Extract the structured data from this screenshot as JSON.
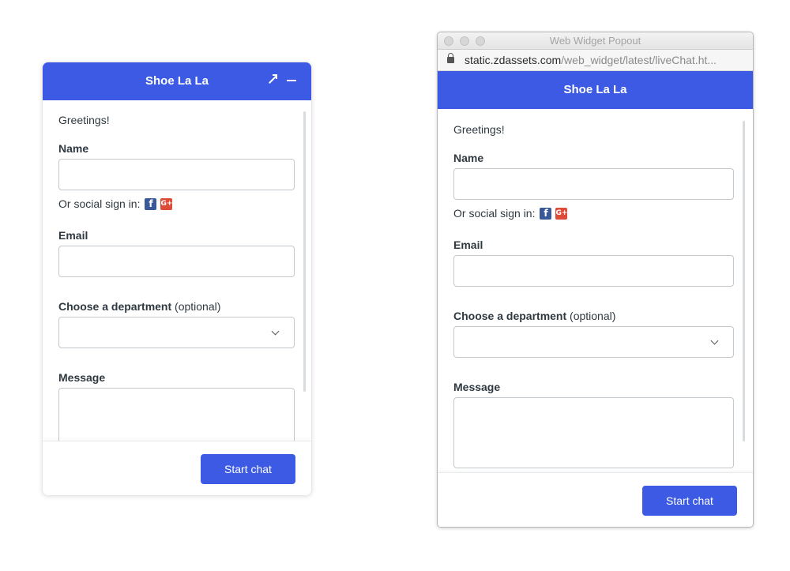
{
  "brand_color": "#3c5ae4",
  "embedded_widget": {
    "header": {
      "title": "Shoe La La",
      "popout_icon": "popout-arrow-icon",
      "minimize_icon": "minimize-icon"
    },
    "form": {
      "greeting": "Greetings!",
      "name_label": "Name",
      "social_label": "Or social sign in:",
      "email_label": "Email",
      "department_label": "Choose a department",
      "department_optional": "(optional)",
      "department_value": "",
      "message_label": "Message"
    },
    "start_chat_label": "Start chat"
  },
  "popout_window": {
    "window_title": "Web Widget Popout",
    "url_host": "static.zdassets.com",
    "url_path": "/web_widget/latest/liveChat.ht...",
    "header": {
      "title": "Shoe La La"
    },
    "form": {
      "greeting": "Greetings!",
      "name_label": "Name",
      "social_label": "Or social sign in:",
      "email_label": "Email",
      "department_label": "Choose a department",
      "department_optional": "(optional)",
      "department_value": "",
      "message_label": "Message"
    },
    "start_chat_label": "Start chat"
  },
  "social_icons": {
    "facebook": "f",
    "google": "G+"
  }
}
